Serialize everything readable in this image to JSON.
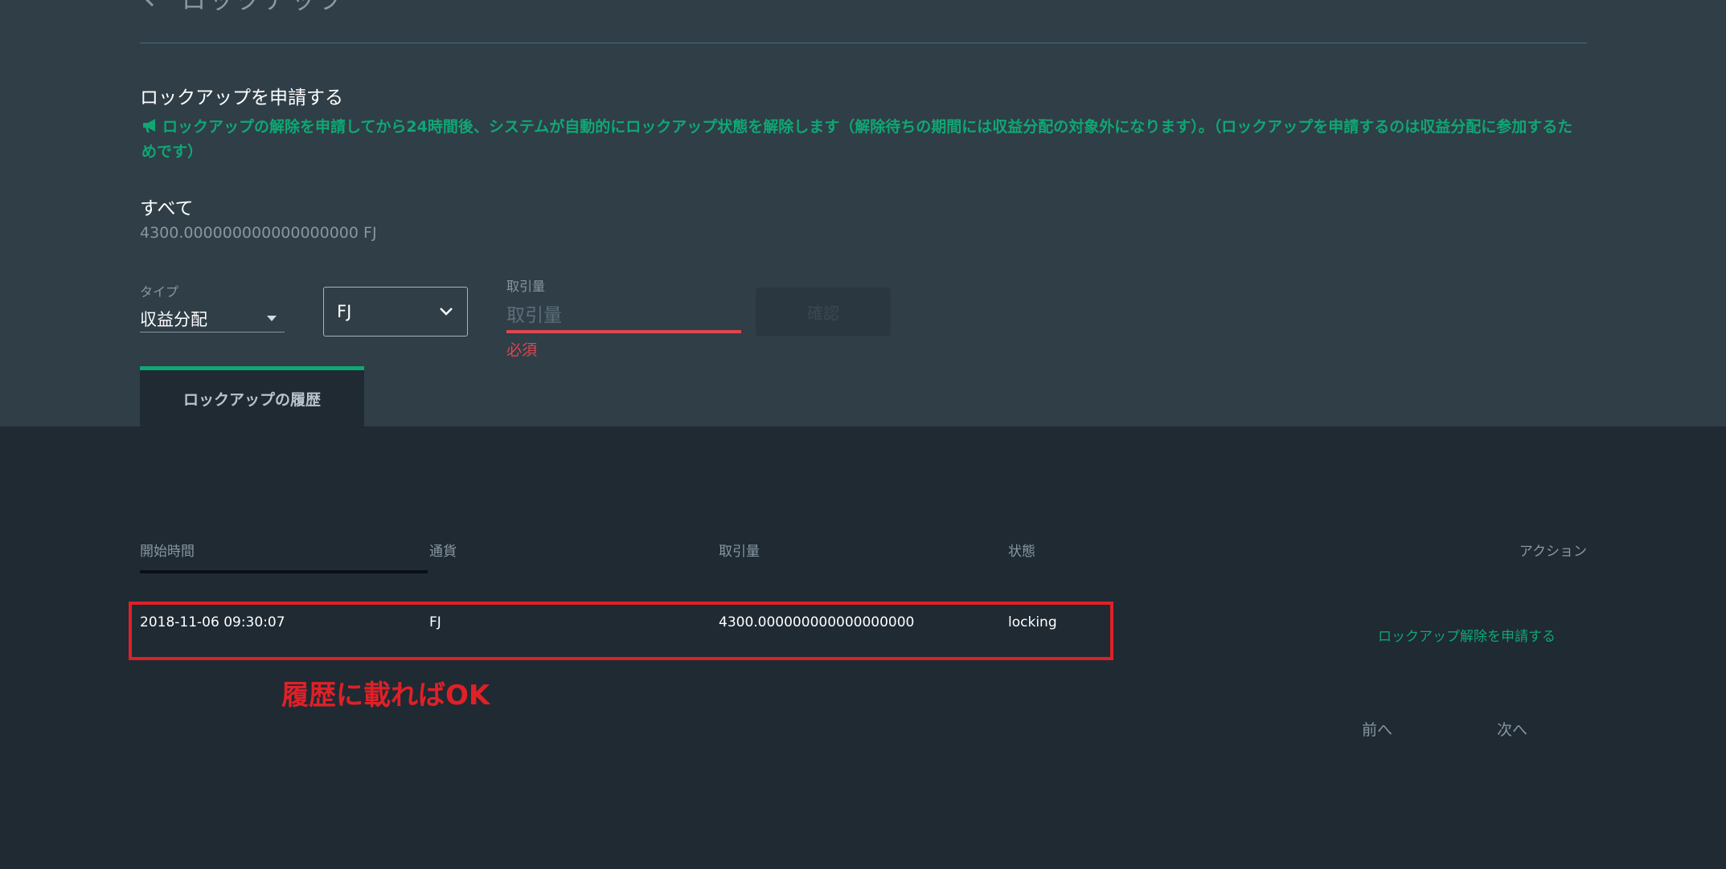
{
  "header": {
    "title": "ロックアップ"
  },
  "lockup_form": {
    "section_title": "ロックアップを申請する",
    "notice": "ロックアップの解除を申請してから24時間後、システムが自動的にロックアップ状態を解除します（解除待ちの期間には収益分配の対象外になります）。（ロックアップを申請するのは収益分配に参加するためです）",
    "all_label": "すべて",
    "all_value": "4300.000000000000000000 FJ",
    "type_label": "タイプ",
    "type_value": "収益分配",
    "currency_value": "FJ",
    "amount_label": "取引量",
    "amount_placeholder": "取引量",
    "amount_value": "",
    "required_msg": "必須",
    "confirm_label": "確認"
  },
  "tabs": [
    {
      "label": "ロックアップの履歴",
      "active": true
    }
  ],
  "history_table": {
    "columns": [
      "開始時間",
      "通貨",
      "取引量",
      "状態",
      "アクション"
    ],
    "rows": [
      {
        "start_time": "2018-11-06 09:30:07",
        "currency": "FJ",
        "amount": "4300.000000000000000000",
        "status": "locking",
        "action": "ロックアップ解除を申請する"
      }
    ]
  },
  "annotation": "履歴に載ればOK",
  "pagination": {
    "prev": "前へ",
    "next": "次へ"
  },
  "colors": {
    "accent": "#0fa773",
    "error": "#e0464f",
    "annotation": "#e02027",
    "top_background": "#2f3e47",
    "bottom_background": "#1f2a33"
  }
}
